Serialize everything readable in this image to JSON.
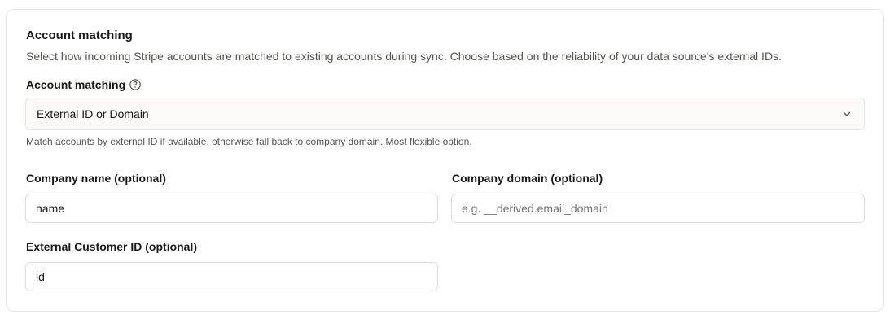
{
  "section": {
    "title": "Account matching",
    "description": "Select how incoming Stripe accounts are matched to existing accounts during sync. Choose based on the reliability of your data source's external IDs."
  },
  "account_matching": {
    "label": "Account matching",
    "help_icon": "question-circle-icon",
    "selected": "External ID or Domain",
    "chevron_icon": "chevron-down-icon",
    "hint": "Match accounts by external ID if available, otherwise fall back to company domain. Most flexible option."
  },
  "company_name": {
    "label": "Company name (optional)",
    "value": "name"
  },
  "company_domain": {
    "label": "Company domain (optional)",
    "value": "",
    "placeholder": "e.g. __derived.email_domain"
  },
  "external_customer_id": {
    "label": "External Customer ID (optional)",
    "value": "id"
  },
  "colors": {
    "border": "#e7e3dc",
    "select_bg": "#fbfaf8",
    "text": "#1c1917",
    "muted_text": "#57534e"
  }
}
